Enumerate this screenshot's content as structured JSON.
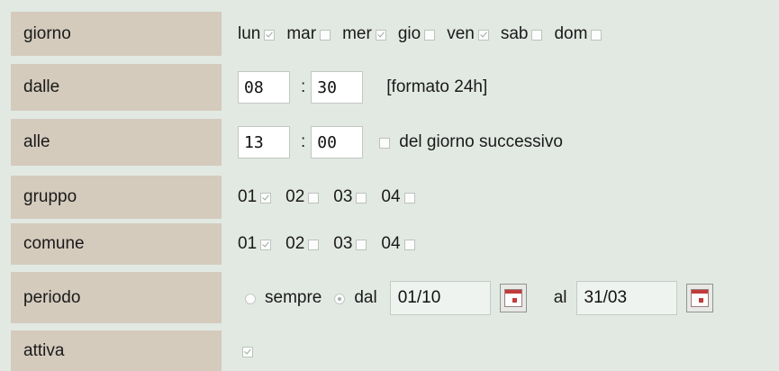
{
  "rows": {
    "giorno": {
      "label": "giorno",
      "options": [
        {
          "label": "lun",
          "checked": true
        },
        {
          "label": "mar",
          "checked": false
        },
        {
          "label": "mer",
          "checked": true
        },
        {
          "label": "gio",
          "checked": false
        },
        {
          "label": "ven",
          "checked": true
        },
        {
          "label": "sab",
          "checked": false
        },
        {
          "label": "dom",
          "checked": false
        }
      ]
    },
    "dalle": {
      "label": "dalle",
      "hours": "08",
      "minutes": "30",
      "separator": ":",
      "hint": "[formato 24h]"
    },
    "alle": {
      "label": "alle",
      "hours": "13",
      "minutes": "00",
      "separator": ":",
      "next_day_label": "del giorno successivo",
      "next_day_checked": false
    },
    "gruppo": {
      "label": "gruppo",
      "options": [
        {
          "label": "01",
          "checked": true
        },
        {
          "label": "02",
          "checked": false
        },
        {
          "label": "03",
          "checked": false
        },
        {
          "label": "04",
          "checked": false
        }
      ]
    },
    "comune": {
      "label": "comune",
      "options": [
        {
          "label": "01",
          "checked": true
        },
        {
          "label": "02",
          "checked": false
        },
        {
          "label": "03",
          "checked": false
        },
        {
          "label": "04",
          "checked": false
        }
      ]
    },
    "periodo": {
      "label": "periodo",
      "always_label": "sempre",
      "always_selected": false,
      "from_label": "dal",
      "from_selected": true,
      "from_value": "01/10",
      "to_label": "al",
      "to_value": "31/03",
      "calendar_icon": "calendar-icon"
    },
    "attiva": {
      "label": "attiva",
      "checked": true
    }
  },
  "colors": {
    "background": "#e2e9e3",
    "label_cell": "#d4cbbd",
    "input_bg": "#ffffff",
    "date_bg": "#eef3ef"
  }
}
